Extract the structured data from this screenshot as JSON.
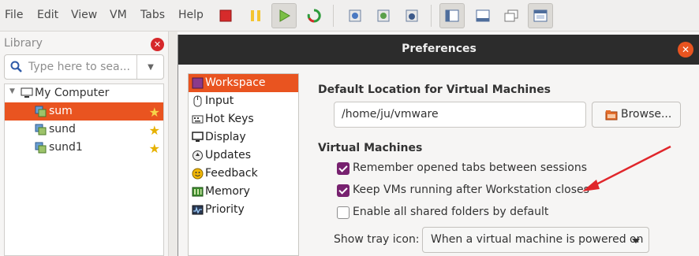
{
  "menubar": {
    "items": [
      "File",
      "Edit",
      "View",
      "VM",
      "Tabs",
      "Help"
    ]
  },
  "toolbar": {
    "icons": [
      "power-off-icon",
      "suspend-icon",
      "power-on-icon",
      "restart-icon",
      "snapshot-icon",
      "revert-snapshot-icon",
      "snapshot-manager-icon",
      "library-view-icon",
      "status-bar-icon",
      "unity-icon",
      "fullscreen-icon"
    ]
  },
  "library": {
    "title": "Library",
    "search_placeholder": "Type here to sea...",
    "tree": {
      "root": "My Computer",
      "items": [
        "sum",
        "sund",
        "sund1"
      ]
    }
  },
  "dialog": {
    "title": "Preferences",
    "categories": [
      "Workspace",
      "Input",
      "Hot Keys",
      "Display",
      "Updates",
      "Feedback",
      "Memory",
      "Priority"
    ],
    "default_location_heading": "Default Location for Virtual Machines",
    "default_location_value": "/home/ju/vmware",
    "browse_label": "Browse...",
    "vm_heading": "Virtual Machines",
    "checkboxes": [
      {
        "label": "Remember opened tabs between sessions",
        "checked": true
      },
      {
        "label": "Keep VMs running after Workstation closes",
        "checked": true
      },
      {
        "label": "Enable all shared folders by default",
        "checked": false
      }
    ],
    "tray_label": "Show tray icon:",
    "tray_value": "When a virtual machine is powered on"
  },
  "colors": {
    "accent": "#e95420",
    "checkbox": "#77216f",
    "annotation_arrow": "#e0262b"
  }
}
